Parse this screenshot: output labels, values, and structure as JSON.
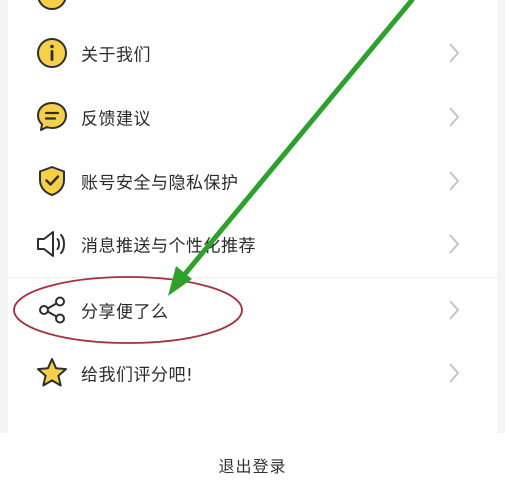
{
  "menu": {
    "items": [
      {
        "label": "关于我们",
        "icon": "info-icon"
      },
      {
        "label": "反馈建议",
        "icon": "chat-bubble-icon"
      },
      {
        "label": "账号安全与隐私保护",
        "icon": "shield-check-icon"
      },
      {
        "label": "消息推送与个性化推荐",
        "icon": "speaker-icon"
      },
      {
        "label": "分享便了么",
        "icon": "share-icon"
      },
      {
        "label": "给我们评分吧!",
        "icon": "star-icon"
      }
    ]
  },
  "footer": {
    "logout_label": "退出登录"
  },
  "colors": {
    "icon_fill": "#f7d04a",
    "icon_stroke": "#2e2e2e",
    "chevron": "#c4c4c4",
    "annotation_arrow": "#2ea02e",
    "annotation_ellipse": "#a5303e"
  }
}
